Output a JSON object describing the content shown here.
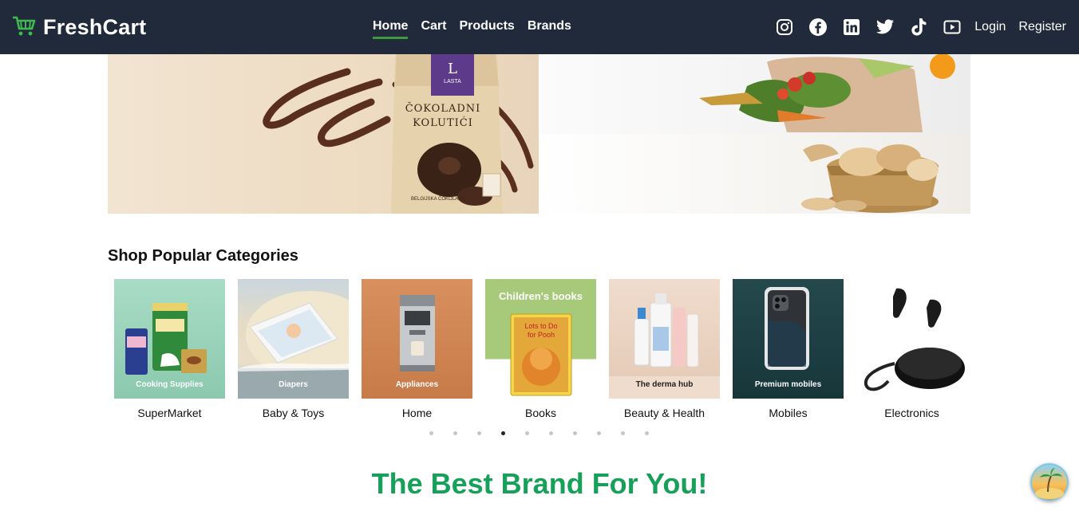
{
  "navbar": {
    "brand": "FreshCart",
    "links": [
      "Home",
      "Cart",
      "Products",
      "Brands"
    ],
    "active_link": "Home",
    "socials": [
      "instagram-icon",
      "facebook-icon",
      "linkedin-icon",
      "twitter-icon",
      "tiktok-icon",
      "youtube-icon"
    ],
    "login": "Login",
    "register": "Register"
  },
  "hero": {
    "product_brand": "LASTA",
    "product_name_line1": "ČOKOLADNI",
    "product_name_line2": "KOLUTIĆI",
    "product_footer": "BELGIJSKA ČOKOLADA"
  },
  "categories": {
    "title": "Shop Popular Categories",
    "items": [
      {
        "name": "SuperMarket",
        "caption": "Cooking Supplies"
      },
      {
        "name": "Baby & Toys",
        "caption": "Diapers"
      },
      {
        "name": "Home",
        "caption": "Appliances"
      },
      {
        "name": "Books",
        "caption": "Children's books"
      },
      {
        "name": "Beauty & Health",
        "caption": "The derma hub"
      },
      {
        "name": "Mobiles",
        "caption": "Premium mobiles"
      },
      {
        "name": "Electronics",
        "caption": ""
      }
    ],
    "carousel_dots": 10,
    "active_dot": 3
  },
  "brands": {
    "heading": "The Best Brand For You!"
  },
  "colors": {
    "navbar_bg": "#212a3a",
    "brand_green": "#3c9a3c",
    "heading_green": "#16a05a"
  }
}
